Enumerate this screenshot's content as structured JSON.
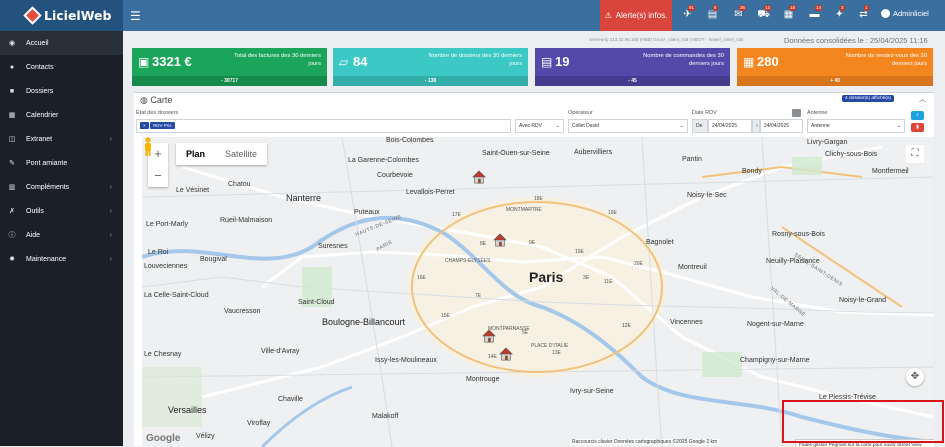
{
  "app": {
    "brand": "LicielWeb"
  },
  "header": {
    "alert_label": "Alerte(s) infos.",
    "badges": [
      "91",
      "8",
      "36",
      "13",
      "18",
      "14",
      "3",
      "1"
    ],
    "user_name": "Adminliciel"
  },
  "sidebar": {
    "items": [
      {
        "label": "Accueil",
        "icon": "dashboard-icon",
        "sub": false
      },
      {
        "label": "Contacts",
        "icon": "user-icon",
        "sub": false
      },
      {
        "label": "Dossiers",
        "icon": "folder-icon",
        "sub": false
      },
      {
        "label": "Calendrier",
        "icon": "calendar-icon",
        "sub": false
      },
      {
        "label": "Extranet",
        "icon": "share-icon",
        "sub": true
      },
      {
        "label": "Pont amiante",
        "icon": "wrench-icon",
        "sub": false
      },
      {
        "label": "Compléments",
        "icon": "chart-icon",
        "sub": true
      },
      {
        "label": "Outils",
        "icon": "tools-icon",
        "sub": true
      },
      {
        "label": "Aide",
        "icon": "info-icon",
        "sub": true
      },
      {
        "label": "Maintenance",
        "icon": "gear-icon",
        "sub": true
      }
    ]
  },
  "meta": {
    "server_line": "ServeurIp 213.32.96.168 (HBE) GrosA_client_ruB | 86077 - liciwel_client_ruB",
    "consolidated": "Données consolidées le : 25/04/2025 11:16"
  },
  "cards": [
    {
      "value": "3321 €",
      "label": "Total des factures des 30 derniers jours",
      "foot": "- 30717",
      "color": "#1aa55a",
      "icon": "money-icon"
    },
    {
      "value": "84",
      "label": "Nombre de dossiers des 30 derniers jours",
      "foot": "- 138",
      "color": "#3cc8c4",
      "icon": "folder-open-icon"
    },
    {
      "value": "19",
      "label": "Nombre de commandes des 30 derniers jours",
      "foot": "- 45",
      "color": "#5448a8",
      "icon": "list-icon"
    },
    {
      "value": "280",
      "label": "Nombre de rendez-vous des 30 derniers jours",
      "foot": "+ 40",
      "color": "#f3861f",
      "icon": "calendar-check-icon"
    }
  ],
  "carte": {
    "title": "Carte",
    "count_badge": "4 dossier(s) affiché(s)",
    "filters": {
      "etat_label": "État des dossiers",
      "etat_tag": "RDV Pris",
      "rdv_select": "Avec RDV",
      "operateur_label": "Opérateur",
      "operateur_value": "Collet David",
      "date_label": "Date RDV",
      "date_prefix": "De",
      "date_from": "24/04/2025",
      "date_to": "24/04/2025",
      "antenne_label": "Antenne",
      "antenne_value": "Antenne"
    }
  },
  "map": {
    "type_plan": "Plan",
    "type_satellite": "Satellite",
    "city": "Paris",
    "labels": [
      "Bois-Colombes",
      "Saint-Ouen-sur-Seine",
      "Aubervilliers",
      "Livry-Gargan",
      "La Garenne-Colombes",
      "Clichy-sous-Bois",
      "Courbevoie",
      "Le Vésinet",
      "Chatou",
      "Levallois-Perret",
      "Pantin",
      "Bondy",
      "Montfermeil",
      "Nanterre",
      "Noisy-le-Sec",
      "Le Port-Marly",
      "Rueil-Malmaison",
      "Puteaux",
      "Rosny-sous-Bois",
      "Bagnolet",
      "Suresnes",
      "Le Roi",
      "Louveciennes",
      "Bougival",
      "Montreuil",
      "Neuilly-Plaisance",
      "La Celle-Saint-Cloud",
      "Saint-Cloud",
      "Vaucresson",
      "Boulogne-Billancourt",
      "Vincennes",
      "Nogent-sur-Marne",
      "Noisy-le-Grand",
      "Le Chesnay",
      "Ville-d'Avray",
      "Issy-les-Moulineaux",
      "Champigny-sur-Marne",
      "Versailles",
      "Chaville",
      "Montrouge",
      "Ivry-sur-Seine",
      "Le Plessis-Trévise",
      "Viroflay",
      "Vélizy",
      "Malakoff"
    ],
    "arr_labels": [
      "17E",
      "18E",
      "19E",
      "16E",
      "8E",
      "9E",
      "10E",
      "11E",
      "15E",
      "7E",
      "5E",
      "12E",
      "13E",
      "20E",
      "14E",
      "3E"
    ],
    "area_labels": [
      "MONTMARTRE",
      "CHAMPS-ÉLYSÉES",
      "MONTPARNASSE",
      "PLACE D'ITALIE"
    ],
    "roads": [
      "HAUTS-DE-SEINE",
      "PARIS",
      "SEINE-SAINT-DENIS",
      "VAL-DE-MARNE"
    ],
    "google_logo": "Google",
    "attribution": "Raccourcis clavier   Données cartographiques ©2025 Google   2 km",
    "pegman_tip": "Faites glisser Pegman sur la carte pour ouvrir Street View"
  }
}
